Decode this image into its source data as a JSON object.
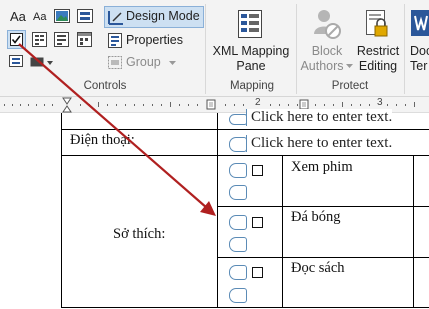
{
  "ribbon": {
    "design_mode": "Design Mode",
    "properties": "Properties",
    "group": "Group",
    "xml_mapping_pane_line1": "XML Mapping",
    "xml_mapping_pane_line2": "Pane",
    "block_authors_line1": "Block",
    "block_authors_line2": "Authors",
    "restrict_editing_line1": "Restrict",
    "restrict_editing_line2": "Editing",
    "doc_template_line1": "Doc",
    "doc_template_line2": "Ter",
    "groups": {
      "controls": "Controls",
      "mapping": "Mapping",
      "protect": "Protect"
    },
    "text_aa_large": "Aa",
    "text_aa_small": "Aa"
  },
  "ruler": {
    "tick_1": "1",
    "tick_2": "2",
    "tick_3": "3"
  },
  "table": {
    "phone_label": "Điện thoại:",
    "hobby_label": "Sở thích:",
    "placeholder_top": "Click here to enter text.",
    "placeholder_phone": "Click here to enter text.",
    "hobbies": [
      "Xem phim",
      "Đá bóng",
      "Đọc sách"
    ]
  },
  "colors": {
    "arrow": "#b02020",
    "accent": "#2b579a",
    "cc_border": "#5b8bb6"
  }
}
